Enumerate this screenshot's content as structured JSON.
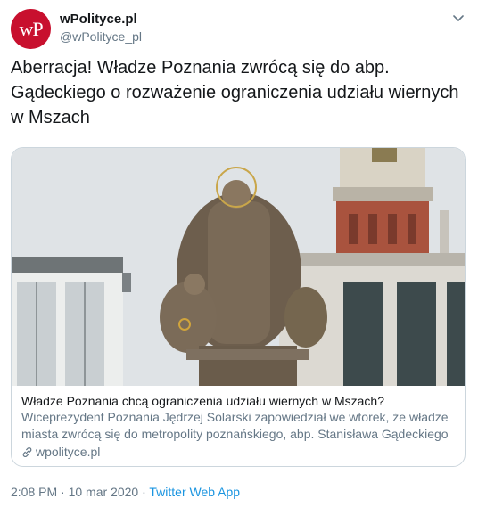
{
  "account": {
    "avatar_text": "wP",
    "name": "wPolityce.pl",
    "handle": "@wPolityce_pl"
  },
  "tweet": {
    "text": "Aberracja! Władze Poznania zwrócą się do abp. Gądeckiego o rozważenie ograniczenia udziału wiernych w Mszach"
  },
  "card": {
    "title": "Władze Poznania chcą ograniczenia udziału wiernych w Mszach?",
    "description": "Wiceprezydent Poznania Jędrzej Solarski zapowiedział we wtorek, że władze miasta zwrócą się do metropolity poznańskiego, abp. Stanisława Gądeckiego o ...",
    "domain": "wpolityce.pl",
    "link_icon": "link-icon"
  },
  "meta": {
    "time": "2:08 PM",
    "separator": "·",
    "date": "10 mar 2020",
    "source": "Twitter Web App"
  },
  "colors": {
    "avatar_bg": "#c8102e",
    "secondary_text": "#657786",
    "link": "#1b95e0",
    "border": "#ccd6dd"
  }
}
